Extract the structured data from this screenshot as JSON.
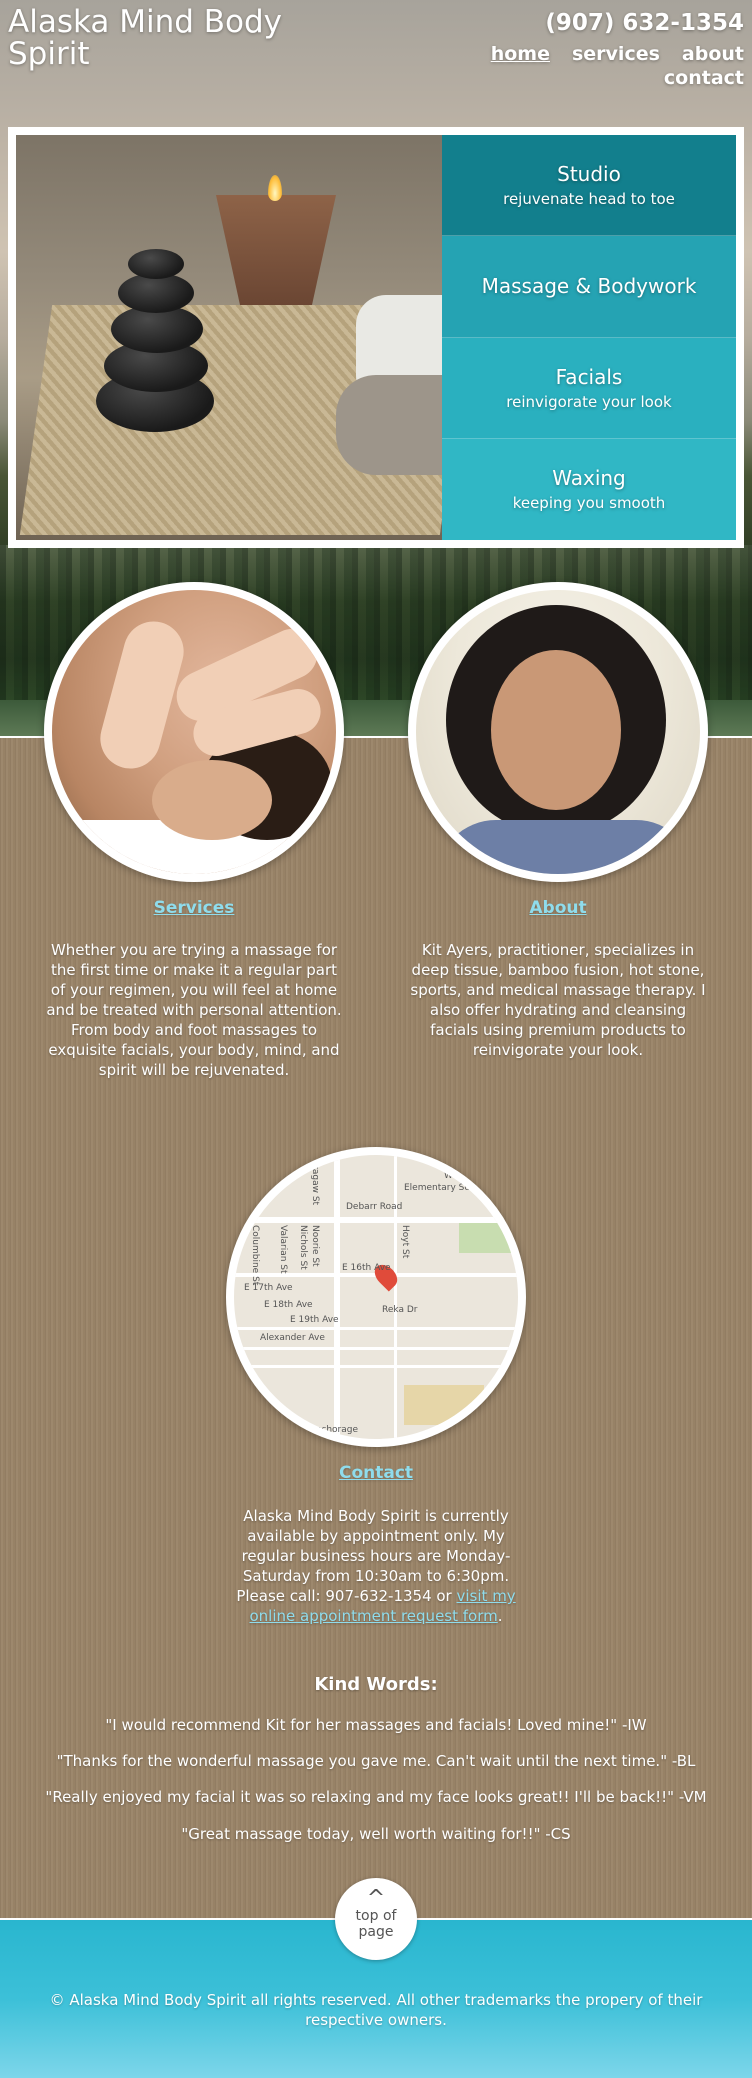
{
  "header": {
    "site_title": "Alaska Mind Body Spirit",
    "phone": "(907) 632-1354",
    "nav": [
      "home",
      "services",
      "about",
      "contact"
    ]
  },
  "hero": {
    "items": [
      {
        "title": "Studio",
        "subtitle": "rejuvenate head to toe"
      },
      {
        "title": "Massage & Bodywork",
        "subtitle": ""
      },
      {
        "title": "Facials",
        "subtitle": "reinvigorate your look"
      },
      {
        "title": "Waxing",
        "subtitle": "keeping you smooth"
      }
    ]
  },
  "services": {
    "heading": "Services",
    "text": "Whether you are trying a massage for the first time or make it a regular part of your regimen, you will feel at home and be treated with personal attention. From body and foot massages to exquisite facials, your body, mind, and spirit will be rejuvenated."
  },
  "about": {
    "heading": "About",
    "text": "Kit Ayers, practitioner, specializes in deep tissue, bamboo fusion, hot stone, sports, and medical massage therapy. I also offer hydrating and cleansing facials using premium products to reinvigorate your look."
  },
  "map": {
    "labels": [
      "Debarr Road",
      "Bragaw St",
      "Elementary School",
      "Willi",
      "Columbine St",
      "Valarian St",
      "Nichols St",
      "Noorie St",
      "Hoyt St",
      "E 16th Ave",
      "E 17th Ave",
      "E 18th Ave",
      "E 19th Ave",
      "Alexander Ave",
      "Reka Dr",
      "of Anchorage"
    ]
  },
  "contact": {
    "heading": "Contact",
    "text": "Alaska Mind Body Spirit is currently available by appointment only. My regular business hours are Monday-Saturday from 10:30am to 6:30pm. Please call: 907-632-1354 or",
    "link_text": "visit my online appointment request form",
    "after_link": "."
  },
  "kind_words": {
    "title": "Kind Words:",
    "testimonials": [
      "\"I would recommend Kit for her massages and facials! Loved mine!\" -IW",
      "\"Thanks for the wonderful massage you gave me. Can't wait until the next time.\" -BL",
      "\"Really enjoyed my facial it was so relaxing and my face looks great!! I'll be back!!\" -VM",
      "\"Great massage today, well worth waiting for!!\" -CS"
    ]
  },
  "top_button": {
    "symbol": "^",
    "line1": "top of",
    "line2": "page"
  },
  "footer": {
    "copyright": "© Alaska Mind Body Spirit all rights reserved. All other trademarks the propery of their respective owners."
  }
}
